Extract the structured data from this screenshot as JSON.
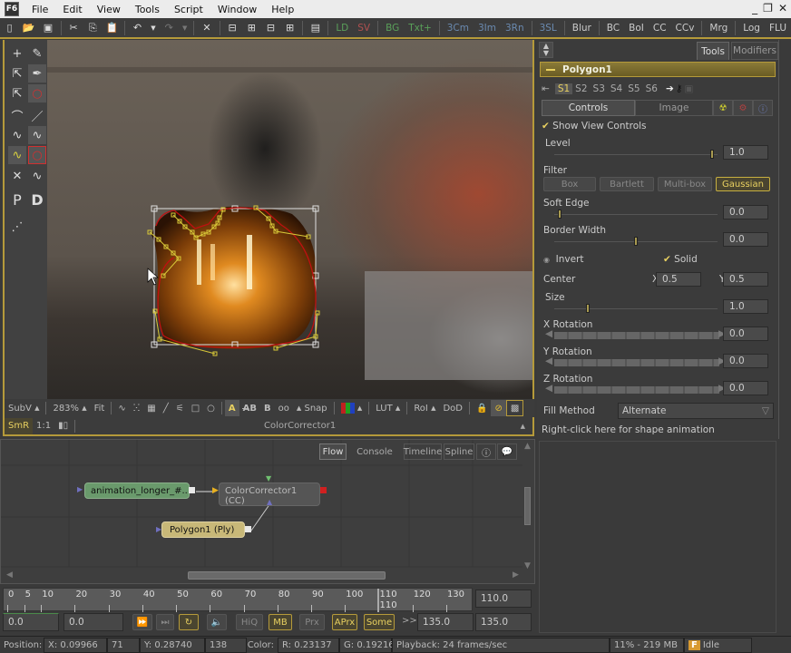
{
  "app": {
    "logo": "F6"
  },
  "menu": [
    "File",
    "Edit",
    "View",
    "Tools",
    "Script",
    "Window",
    "Help"
  ],
  "window_controls": {
    "minimize": "_",
    "restore": "❐",
    "close": "✕"
  },
  "toolbar": {
    "tools": [
      {
        "label": "LD",
        "color": "#5aa05a"
      },
      {
        "label": "SV",
        "color": "#b05050"
      },
      {
        "label": "BG",
        "color": "#5aa05a"
      },
      {
        "label": "Txt+",
        "color": "#5aa05a"
      },
      {
        "label": "3Cm",
        "color": "#6a8ab0"
      },
      {
        "label": "3Im",
        "color": "#6a8ab0"
      },
      {
        "label": "3Rn",
        "color": "#6a8ab0"
      },
      {
        "label": "3SL",
        "color": "#6a8ab0"
      },
      {
        "label": "Blur",
        "color": "#cccccc"
      },
      {
        "label": "BC",
        "color": "#cccccc"
      },
      {
        "label": "BoI",
        "color": "#cccccc"
      },
      {
        "label": "CC",
        "color": "#cccccc"
      },
      {
        "label": "CCv",
        "color": "#cccccc"
      },
      {
        "label": "Mrg",
        "color": "#cccccc"
      },
      {
        "label": "Log",
        "color": "#cccccc"
      },
      {
        "label": "FLU",
        "color": "#cccccc"
      }
    ]
  },
  "viewer": {
    "bar1": {
      "subv": "SubV",
      "zoom": "283%",
      "fit": "Fit",
      "snap": "Snap",
      "lut": "LUT",
      "roi": "RoI",
      "dod": "DoD"
    },
    "bar2": {
      "smr": "SmR",
      "one_to_one": "1:1",
      "node_name": "ColorCorrector1"
    }
  },
  "right_panel": {
    "tabs": {
      "tools": "Tools",
      "modifiers": "Modifiers"
    },
    "tool_name": "Polygon1",
    "shapes": [
      "S1",
      "S2",
      "S3",
      "S4",
      "S5",
      "S6"
    ],
    "subtabs": {
      "controls": "Controls",
      "image": "Image"
    },
    "show_view_controls": "Show View Controls",
    "level": {
      "label": "Level",
      "value": "1.0",
      "fraction": 0.98
    },
    "filter": {
      "label": "Filter",
      "options": [
        "Box",
        "Bartlett",
        "Multi-box",
        "Gaussian"
      ],
      "selected": "Gaussian"
    },
    "soft_edge": {
      "label": "Soft Edge",
      "value": "0.0",
      "fraction": 0.02
    },
    "border_width": {
      "label": "Border Width",
      "value": "0.0",
      "fraction": 0.5
    },
    "invert": {
      "label": "Invert"
    },
    "solid": {
      "label": "Solid"
    },
    "center": {
      "label": "Center",
      "x_label": "X",
      "x": "0.5",
      "y_label": "Y",
      "y": "0.5"
    },
    "size": {
      "label": "Size",
      "value": "1.0",
      "fraction": 0.2
    },
    "x_rotation": {
      "label": "X Rotation",
      "value": "0.0"
    },
    "y_rotation": {
      "label": "Y Rotation",
      "value": "0.0"
    },
    "z_rotation": {
      "label": "Z Rotation",
      "value": "0.0"
    },
    "fill_method": {
      "label": "Fill Method",
      "value": "Alternate"
    },
    "hint": "Right-click here for shape animation"
  },
  "flow": {
    "tabs": [
      "Flow",
      "Console",
      "Timeline",
      "Spline"
    ],
    "active_tab": "Flow",
    "nodes": {
      "loader": "animation_longer_#...",
      "cc": "ColorCorrector1  (CC)",
      "poly": "Polygon1  (Ply)"
    }
  },
  "timeline": {
    "ticks": [
      "0",
      "5",
      "10",
      "20",
      "30",
      "40",
      "50",
      "60",
      "70",
      "80",
      "90",
      "100",
      "110",
      "120",
      "130"
    ],
    "current_frame_marker": "110",
    "current_field": "110.0"
  },
  "transport": {
    "start": "0.0",
    "render_start": "0.0",
    "buttons": [
      "HiQ",
      "MB",
      "Prx",
      "APrx",
      "Some"
    ],
    "buttons_on": [
      "MB",
      "APrx",
      "Some"
    ],
    "more": ">>",
    "render_end": "135.0",
    "end": "135.0"
  },
  "status": {
    "position_label": "Position:",
    "x_label": "X:",
    "x": "0.09966",
    "px": "71",
    "y_label": "Y:",
    "y": "0.28740",
    "py": "138",
    "color_label": "Color:",
    "r_label": "R:",
    "r": "0.23137",
    "g_label": "G:",
    "g": "0.19216",
    "playback": "Playback: 24 frames/sec",
    "memory": "11% -  219 MB",
    "state": "Idle"
  }
}
